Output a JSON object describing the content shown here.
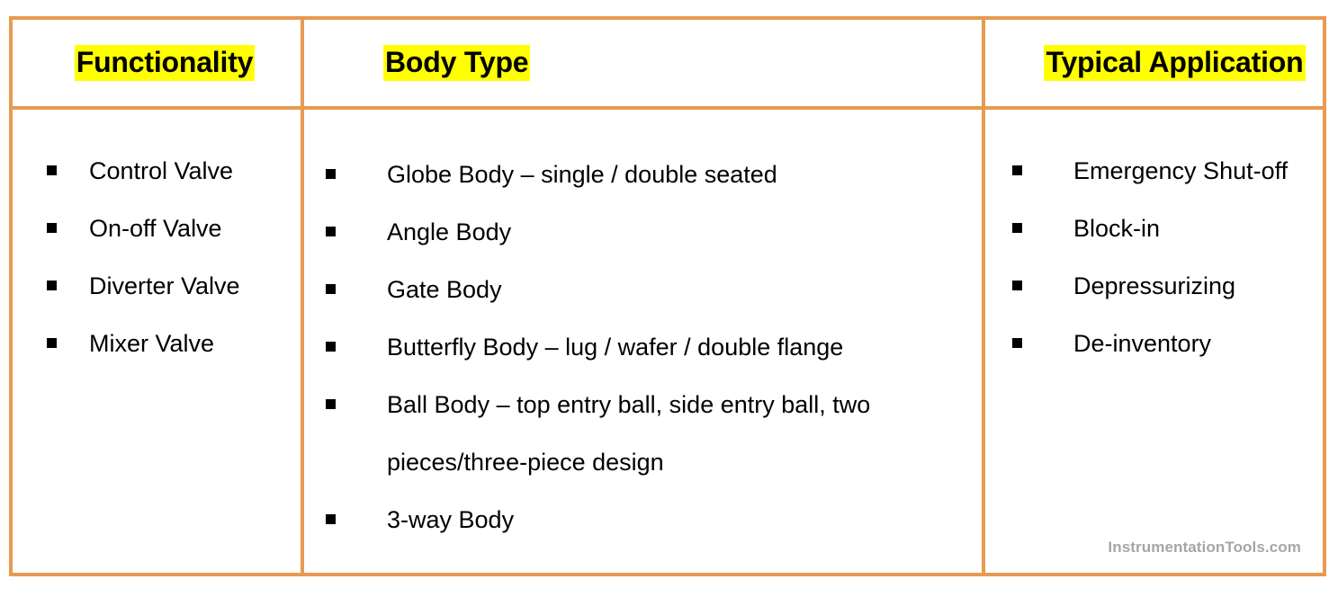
{
  "table": {
    "border_color": "#e89a50",
    "highlight_color": "#ffff00",
    "text_color": "#000000",
    "headers": [
      {
        "label": "Functionality"
      },
      {
        "label": "Body Type"
      },
      {
        "label": "Typical Application"
      }
    ],
    "columns": [
      {
        "name": "functionality",
        "items": [
          "Control Valve",
          "On-off Valve",
          "Diverter Valve",
          "Mixer Valve"
        ]
      },
      {
        "name": "body-type",
        "items": [
          "Globe Body – single / double seated",
          "Angle Body",
          "Gate Body",
          "Butterfly Body – lug / wafer / double flange",
          "Ball Body – top entry ball, side entry ball, two pieces/three-piece design",
          "3-way Body"
        ]
      },
      {
        "name": "typical-application",
        "items": [
          "Emergency Shut-off",
          "Block-in",
          "Depressurizing",
          "De-inventory"
        ]
      }
    ]
  },
  "watermark": {
    "text": "InstrumentationTools.com",
    "color": "#a6a6a6"
  }
}
